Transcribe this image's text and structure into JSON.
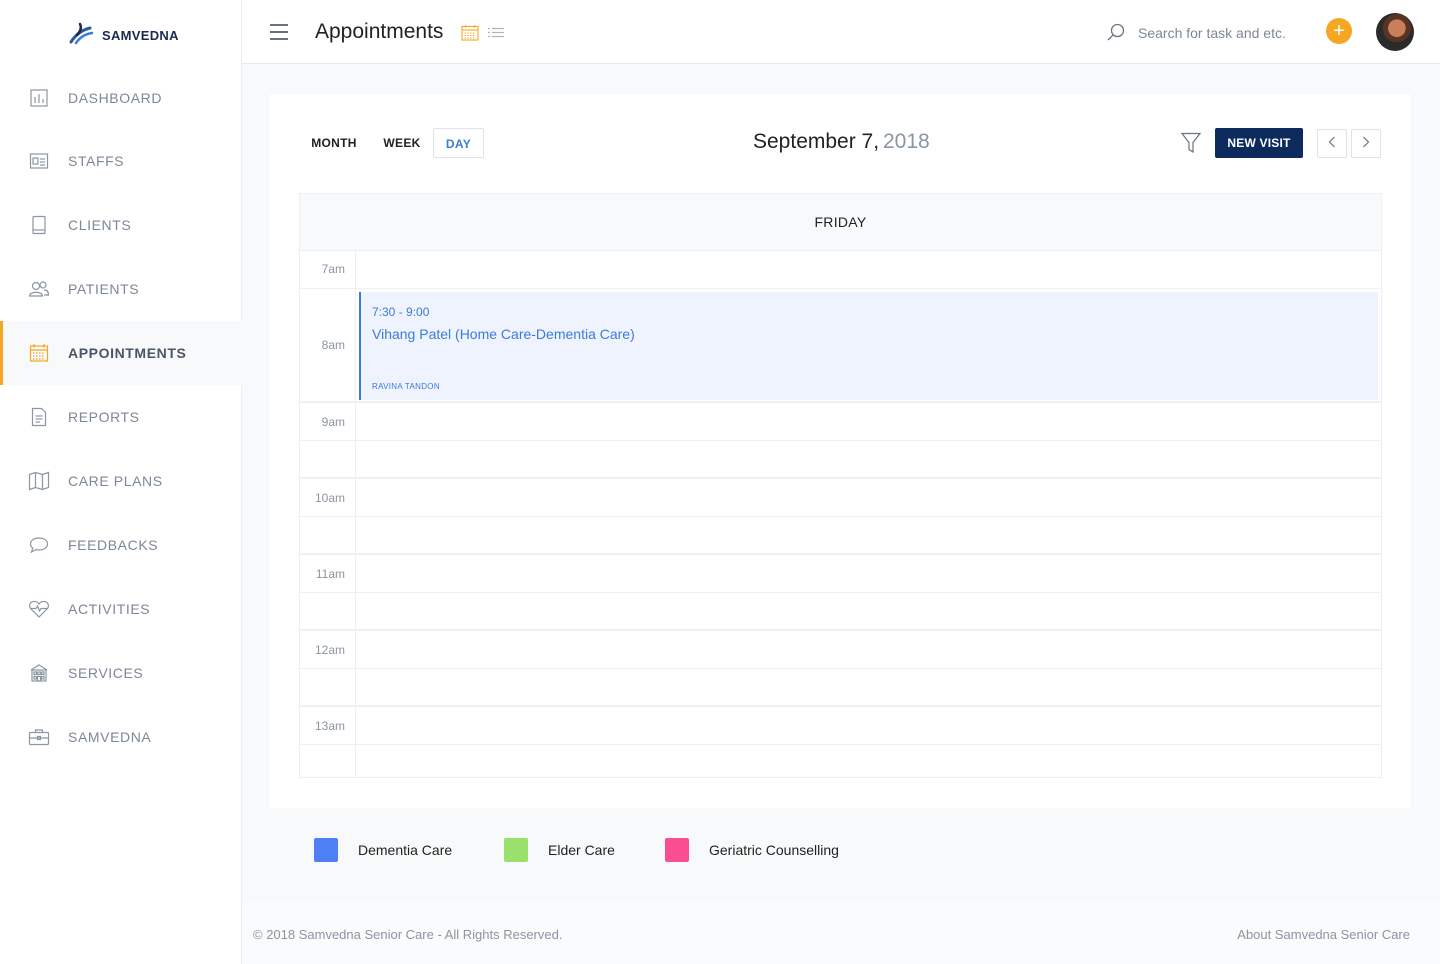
{
  "brand": {
    "name": "SAMVEDNA"
  },
  "sidebar": {
    "items": [
      {
        "label": "DASHBOARD",
        "icon": "dashboard-icon"
      },
      {
        "label": "STAFFS",
        "icon": "staff-card-icon"
      },
      {
        "label": "CLIENTS",
        "icon": "clients-book-icon"
      },
      {
        "label": "PATIENTS",
        "icon": "patients-users-icon"
      },
      {
        "label": "APPOINTMENTS",
        "icon": "calendar-icon",
        "active": true
      },
      {
        "label": "REPORTS",
        "icon": "report-document-icon"
      },
      {
        "label": "CARE PLANS",
        "icon": "map-icon"
      },
      {
        "label": "FEEDBACKS",
        "icon": "chat-bubble-icon"
      },
      {
        "label": "ACTIVITIES",
        "icon": "heart-pulse-icon"
      },
      {
        "label": "SERVICES",
        "icon": "building-icon"
      },
      {
        "label": "SAMVEDNA",
        "icon": "briefcase-icon"
      }
    ],
    "accent_color": "#f5a623"
  },
  "header": {
    "title": "Appointments",
    "search_placeholder": "Search for task and etc.",
    "add_label": "+"
  },
  "calendar": {
    "views": [
      "MONTH",
      "WEEK",
      "DAY"
    ],
    "active_view": "DAY",
    "date_main": "September 7,",
    "date_year": "2018",
    "new_visit_label": "NEW VISIT",
    "day_header": "FRIDAY",
    "time_labels": [
      "7am",
      "8am",
      "9am",
      "10am",
      "11am",
      "12am",
      "13am"
    ],
    "event": {
      "time": "7:30 - 9:00",
      "title": "Vihang Patel (Home Care-Dementia Care)",
      "staff": "RAVINA TANDON",
      "color": "#3d7bd9"
    }
  },
  "legend": [
    {
      "label": "Dementia Care",
      "color": "#4f7ff5"
    },
    {
      "label": "Elder Care",
      "color": "#99e06c"
    },
    {
      "label": "Geriatric Counselling",
      "color": "#fa4e93"
    }
  ],
  "footer": {
    "copyright": "© 2018 Samvedna Senior Care - All Rights Reserved.",
    "about": "About Samvedna Senior Care"
  }
}
